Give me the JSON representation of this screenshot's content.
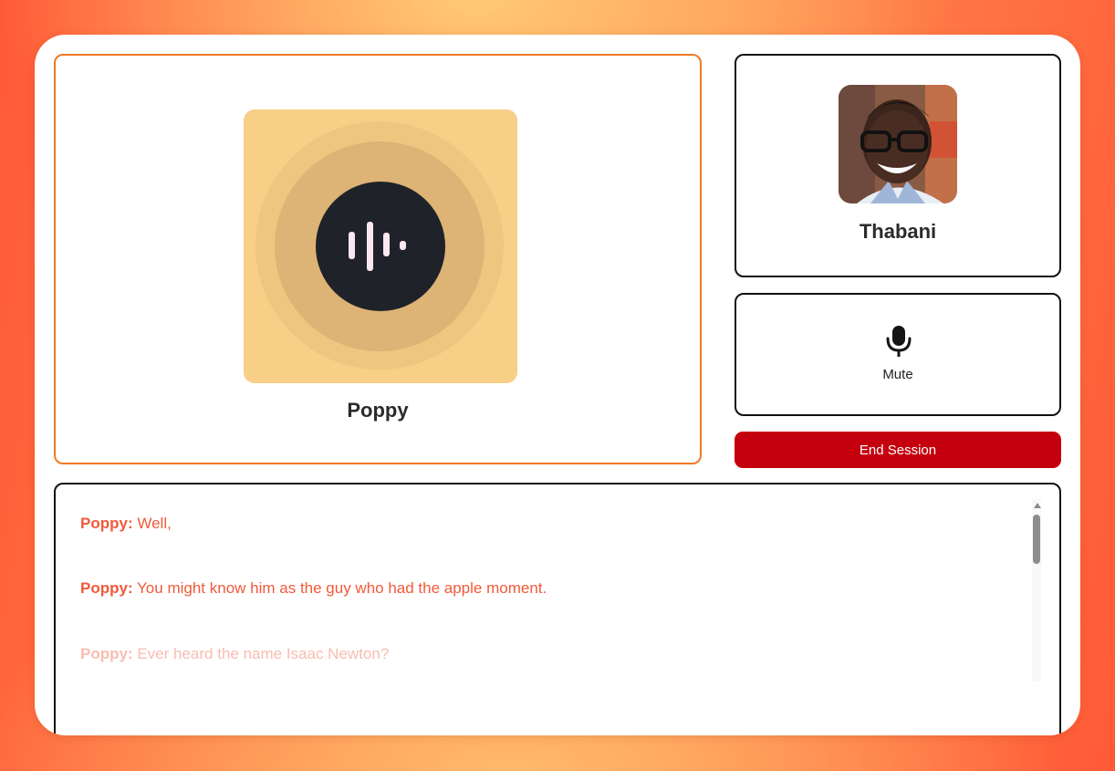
{
  "agent": {
    "name": "Poppy"
  },
  "user": {
    "name": "Thabani"
  },
  "controls": {
    "mute_label": "Mute",
    "end_session_label": "End Session"
  },
  "transcript": {
    "messages": [
      {
        "speaker": "Poppy:",
        "text": "Well,"
      },
      {
        "speaker": "Poppy:",
        "text": "You might know him as the guy who had the apple moment."
      },
      {
        "speaker": "Poppy:",
        "text": "Ever heard the name Isaac Newton?"
      }
    ]
  },
  "colors": {
    "accent": "#ee7a26",
    "danger": "#c5000e",
    "transcript_text": "#f05a3a",
    "agent_tile": "#f7cf86",
    "orb": "#1f2329"
  },
  "icons": {
    "voice": "sound-wave-icon",
    "mic": "microphone-icon",
    "scroll": "scroll-up-arrow-icon"
  }
}
